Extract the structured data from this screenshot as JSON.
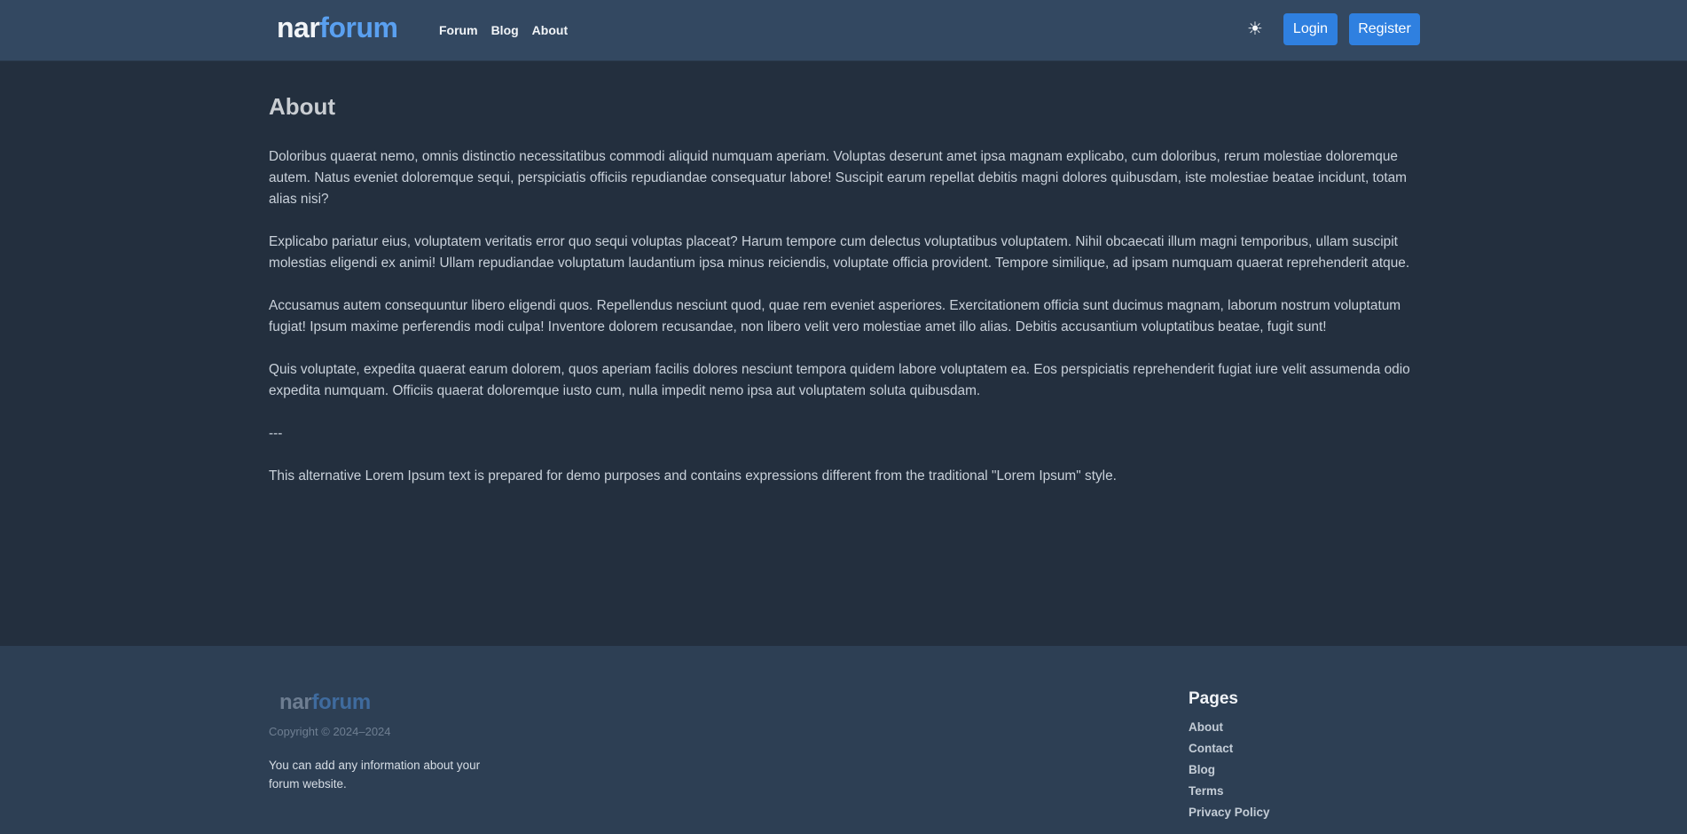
{
  "header": {
    "logo_part1": "nar",
    "logo_part2": "forum",
    "nav": [
      "Forum",
      "Blog",
      "About"
    ],
    "theme_icon": "☀",
    "login_label": "Login",
    "register_label": "Register"
  },
  "main": {
    "title": "About",
    "paragraphs": [
      "Doloribus quaerat nemo, omnis distinctio necessitatibus commodi aliquid numquam aperiam. Voluptas deserunt amet ipsa magnam explicabo, cum doloribus, rerum molestiae doloremque autem. Natus eveniet doloremque sequi, perspiciatis officiis repudiandae consequatur labore! Suscipit earum repellat debitis magni dolores quibusdam, iste molestiae beatae incidunt, totam alias nisi?",
      "Explicabo pariatur eius, voluptatem veritatis error quo sequi voluptas placeat? Harum tempore cum delectus voluptatibus voluptatem. Nihil obcaecati illum magni temporibus, ullam suscipit molestias eligendi ex animi! Ullam repudiandae voluptatum laudantium ipsa minus reiciendis, voluptate officia provident. Tempore similique, ad ipsam numquam quaerat reprehenderit atque.",
      "Accusamus autem consequuntur libero eligendi quos. Repellendus nesciunt quod, quae rem eveniet asperiores. Exercitationem officia sunt ducimus magnam, laborum nostrum voluptatum fugiat! Ipsum maxime perferendis modi culpa! Inventore dolorem recusandae, non libero velit vero molestiae amet illo alias. Debitis accusantium voluptatibus beatae, fugit sunt!",
      "Quis voluptate, expedita quaerat earum dolorem, quos aperiam facilis dolores nesciunt tempora quidem labore voluptatem ea. Eos perspiciatis reprehenderit fugiat iure velit assumenda odio expedita numquam. Officiis quaerat doloremque iusto cum, nulla impedit nemo ipsa aut voluptatem soluta quibusdam.",
      "---",
      "This alternative Lorem Ipsum text is prepared for demo purposes and contains expressions different from the traditional \"Lorem Ipsum\" style."
    ]
  },
  "footer": {
    "logo_part1": "nar",
    "logo_part2": "forum",
    "copyright": "Copyright © 2024–2024",
    "info": "You can add any information about your forum website.",
    "pages_title": "Pages",
    "pages": [
      "About",
      "Contact",
      "Blog",
      "Terms",
      "Privacy Policy"
    ]
  }
}
